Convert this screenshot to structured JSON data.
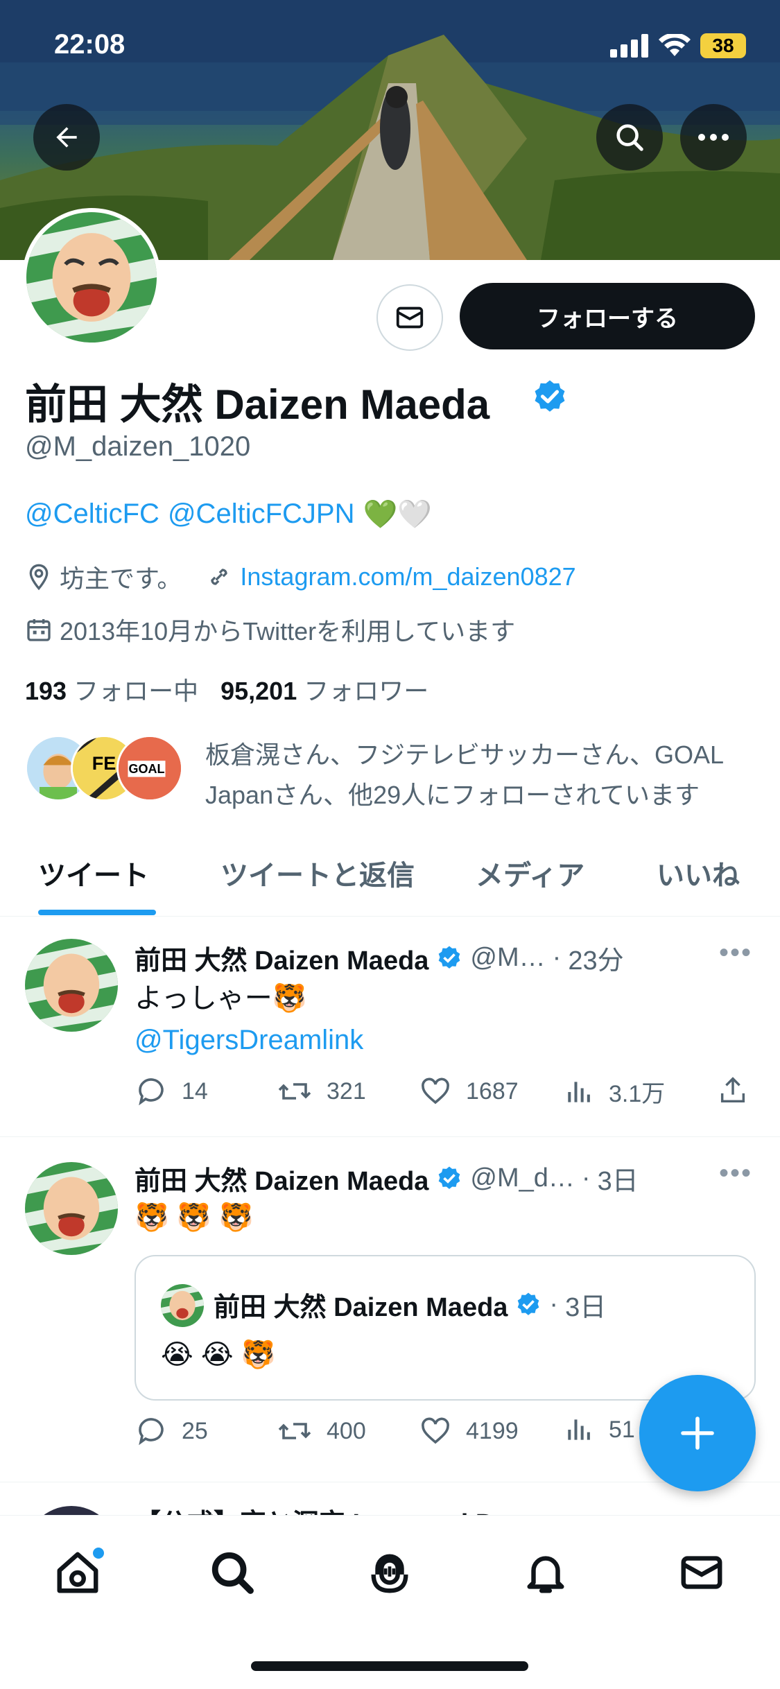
{
  "status_bar": {
    "time": "22:08",
    "battery": "38"
  },
  "profile": {
    "display_name": "前田 大然 Daizen Maeda",
    "handle": "@M_daizen_1020",
    "bio_mentions": [
      "@CelticFC",
      "@CelticFCJPN"
    ],
    "bio_emoji": "💚🤍",
    "location": "坊主です。",
    "website": "Instagram.com/m_daizen0827",
    "joined": "2013年10月からTwitterを利用しています",
    "following_count": "193",
    "following_label": "フォロー中",
    "followers_count": "95,201",
    "followers_label": "フォロワー",
    "followed_by_text": "板倉滉さん、フジテレビサッカーさん、GOAL Japanさん、他29人にフォローされています",
    "follow_button": "フォローする"
  },
  "tabs": [
    {
      "label": "ツイート",
      "active": true
    },
    {
      "label": "ツイートと返信",
      "active": false
    },
    {
      "label": "メディア",
      "active": false
    },
    {
      "label": "いいね",
      "active": false
    }
  ],
  "tweets": [
    {
      "name": "前田 大然 Daizen Maeda",
      "handle": "@M…",
      "time": "23分",
      "text": "よっしゃー🐯",
      "link": "@TigersDreamlink",
      "replies": "14",
      "retweets": "321",
      "likes": "1687",
      "views": "3.1万"
    },
    {
      "name": "前田 大然 Daizen Maeda",
      "handle": "@M_d…",
      "time": "3日",
      "text": "🐯 🐯 🐯",
      "quote": {
        "name": "前田 大然 Daizen Maeda",
        "time": "3日",
        "text": "😭 😭 🐯"
      },
      "replies": "25",
      "retweets": "400",
      "likes": "4199",
      "views": "51"
    },
    {
      "name": "【公式】恋と深空 Love and Deepspace"
    }
  ],
  "colors": {
    "accent": "#1d9bf0",
    "text": "#0f1419",
    "muted": "#536471"
  },
  "icons": [
    "back-arrow-icon",
    "search-icon",
    "more-icon",
    "mail-icon",
    "verified-badge-icon",
    "location-icon",
    "link-icon",
    "calendar-icon",
    "reply-icon",
    "retweet-icon",
    "like-icon",
    "views-icon",
    "share-icon",
    "plus-icon",
    "home-icon",
    "explore-icon",
    "spaces-icon",
    "notifications-icon",
    "messages-icon"
  ]
}
